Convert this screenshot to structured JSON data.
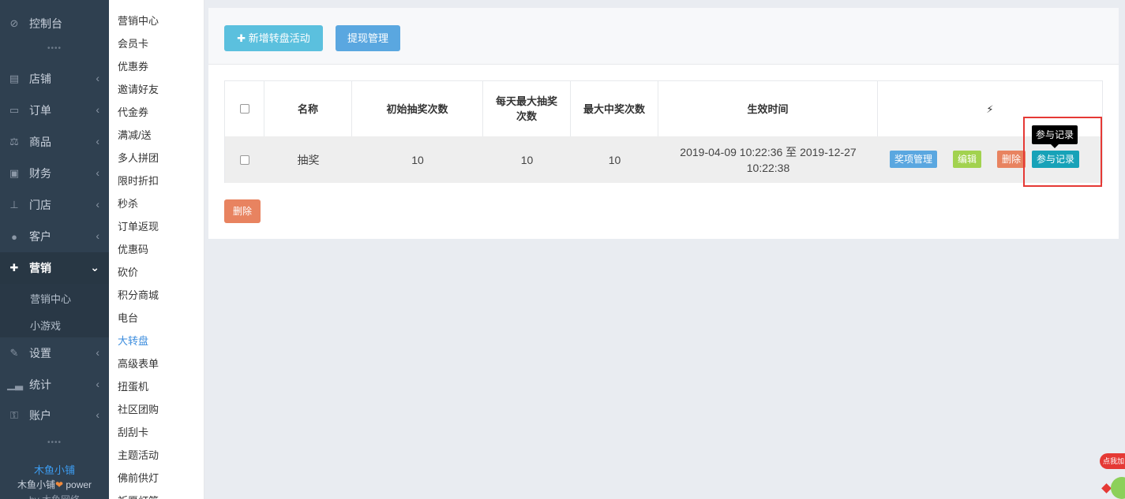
{
  "sidebar": {
    "items": [
      {
        "label": "控制台",
        "icon": "dashboard-icon"
      },
      {
        "label": "店铺",
        "icon": "store-icon"
      },
      {
        "label": "订单",
        "icon": "order-icon"
      },
      {
        "label": "商品",
        "icon": "scale-icon"
      },
      {
        "label": "财务",
        "icon": "money-icon"
      },
      {
        "label": "门店",
        "icon": "sitemap-icon"
      },
      {
        "label": "客户",
        "icon": "users-icon"
      },
      {
        "label": "营销",
        "icon": "gift-icon"
      },
      {
        "label": "设置",
        "icon": "wrench-icon"
      },
      {
        "label": "统计",
        "icon": "signal-icon"
      },
      {
        "label": "账户",
        "icon": "key-icon"
      }
    ],
    "marketing_sub": [
      "营销中心",
      "小游戏"
    ],
    "brand": {
      "name": "木鱼小铺",
      "power_prefix": "木鱼小铺",
      "power_suffix": "power",
      "by": "by 木鱼网络"
    }
  },
  "submenu": {
    "items": [
      "营销中心",
      "会员卡",
      "优惠券",
      "邀请好友",
      "代金券",
      "满减/送",
      "多人拼团",
      "限时折扣",
      "秒杀",
      "订单返现",
      "优惠码",
      "砍价",
      "积分商城",
      "电台",
      "大转盘",
      "高级表单",
      "扭蛋机",
      "社区团购",
      "刮刮卡",
      "主题活动",
      "佛前供灯",
      "祈愿灯笼"
    ],
    "active": "大转盘"
  },
  "toolbar": {
    "add_label": "新增转盘活动",
    "withdraw_label": "提现管理"
  },
  "table": {
    "headers": [
      "名称",
      "初始抽奖次数",
      "每天最大抽奖次数",
      "最大中奖次数",
      "生效时间",
      "⚡"
    ],
    "rows": [
      {
        "name": "抽奖",
        "initial_draws": "10",
        "daily_max_draws": "10",
        "max_wins": "10",
        "effective_time": "2019-04-09 10:22:36 至 2019-12-27 10:22:38",
        "actions": {
          "prize": "奖项管理",
          "edit": "编辑",
          "delete": "删除",
          "records": "参与记录"
        }
      }
    ]
  },
  "tooltip": "参与记录",
  "bulk_delete": "删除",
  "float_widget": {
    "text": "点我加"
  },
  "colors": {
    "sidebar_bg": "#2f4050",
    "accent": "#3c8dde",
    "highlight": "#e53935"
  }
}
